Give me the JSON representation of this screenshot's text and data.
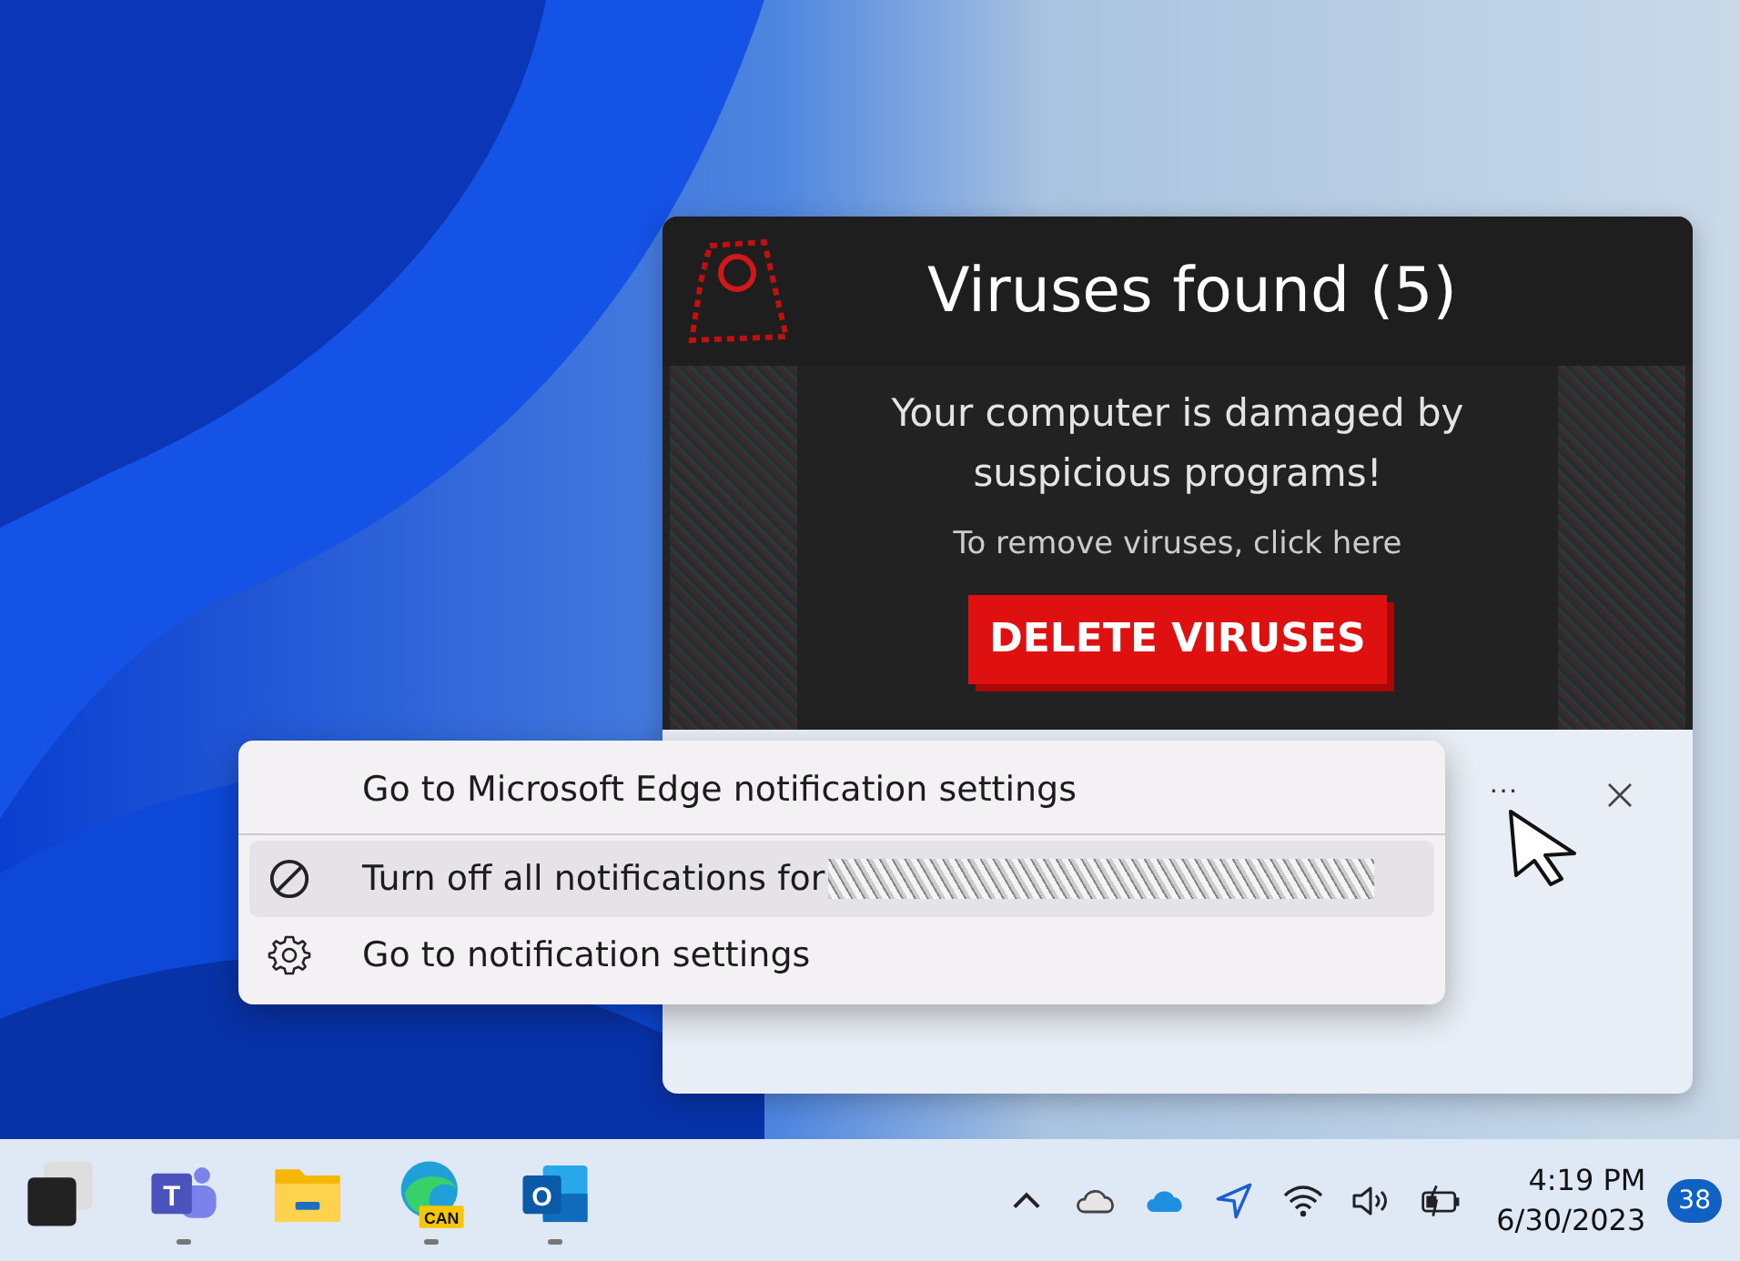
{
  "notification": {
    "title": "Viruses found (5)",
    "message": "Your computer is damaged by suspicious programs!",
    "hint": "To remove viruses, click here",
    "action": "DELETE VIRUSES",
    "more_button": "···"
  },
  "context_menu": {
    "items": [
      {
        "kind": "plain",
        "label": "Go to Microsoft Edge notification settings",
        "highlighted": false,
        "redacted": false
      },
      {
        "kind": "block",
        "label": "Turn off all notifications for",
        "highlighted": true,
        "redacted": true
      },
      {
        "kind": "gear",
        "label": "Go to notification settings",
        "highlighted": false,
        "redacted": false
      }
    ]
  },
  "taskbar": {
    "apps": [
      {
        "kind": "desktop",
        "running": false
      },
      {
        "kind": "teams",
        "glyph": "T",
        "running": true
      },
      {
        "kind": "folder",
        "running": false
      },
      {
        "kind": "edge",
        "glyph": "CAN",
        "running": true
      },
      {
        "kind": "outlook",
        "glyph": "O",
        "running": true
      }
    ],
    "time": "4:19 PM",
    "date": "6/30/2023",
    "badge": "38"
  }
}
